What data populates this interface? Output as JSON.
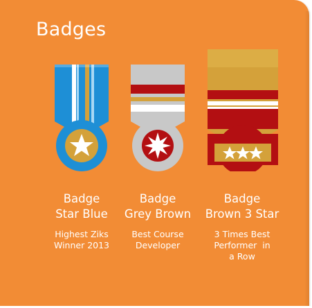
{
  "panel": {
    "title": "Badges",
    "background_color": "#f28c35"
  },
  "badges": [
    {
      "name_line1": "Badge",
      "name_line2": "Star Blue",
      "desc_line1": "Highest Ziks",
      "desc_line2": "Winner 2013",
      "desc_line3": "",
      "icon": "star-blue-medal-icon"
    },
    {
      "name_line1": "Badge",
      "name_line2": "Grey Brown",
      "desc_line1": "Best Course",
      "desc_line2": "Developer",
      "desc_line3": "",
      "icon": "grey-brown-medal-icon"
    },
    {
      "name_line1": "Badge",
      "name_line2": "Brown 3 Star",
      "desc_line1": "3 Times Best",
      "desc_line2": "Performer  in",
      "desc_line3": "a Row",
      "icon": "brown-three-star-medal-icon"
    }
  ]
}
